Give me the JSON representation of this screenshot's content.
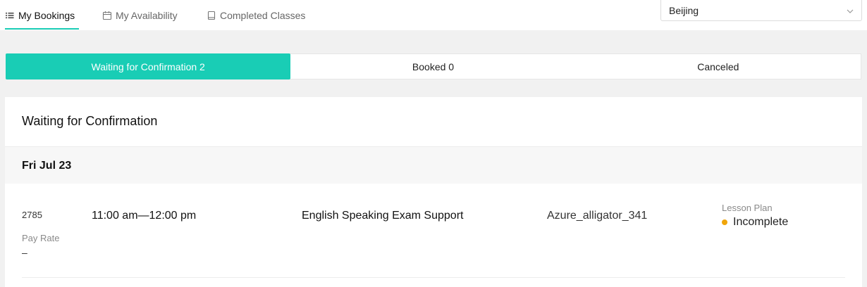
{
  "nav": {
    "tabs": [
      {
        "label": "My Bookings",
        "icon": "list-icon",
        "active": true
      },
      {
        "label": "My Availability",
        "icon": "calendar-icon",
        "active": false
      },
      {
        "label": "Completed Classes",
        "icon": "book-icon",
        "active": false
      }
    ],
    "city": "Beijing",
    "accent_color": "#19cdb5"
  },
  "segments": [
    {
      "label": "Waiting for Confirmation 2",
      "active": true
    },
    {
      "label": "Booked 0",
      "active": false
    },
    {
      "label": "Canceled",
      "active": false
    }
  ],
  "section": {
    "title": "Waiting for Confirmation",
    "date": "Fri Jul 23"
  },
  "booking": {
    "id": "2785",
    "time": "11:00 am—12:00 pm",
    "course": "English Speaking Exam Support",
    "student": "Azure_alligator_341",
    "pay_rate_label": "Pay Rate",
    "pay_rate": "–",
    "lesson_plan_label": "Lesson Plan",
    "lesson_plan_status": "Incomplete",
    "status_color": "#f0a50a"
  }
}
